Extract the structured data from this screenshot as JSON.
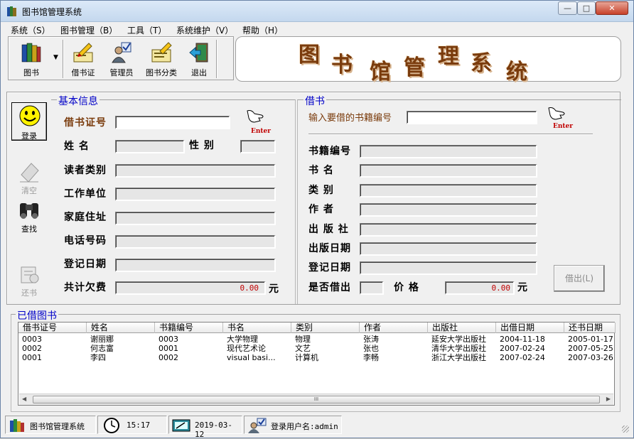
{
  "window": {
    "title": "图书馆管理系统"
  },
  "menu": [
    {
      "label": "系统（S）"
    },
    {
      "label": "图书管理（B）"
    },
    {
      "label": "工具（T）"
    },
    {
      "label": "系统维护（V）"
    },
    {
      "label": "帮助（H）"
    }
  ],
  "toolbar": {
    "books": "图书",
    "card": "借书证",
    "admin": "管理员",
    "category": "图书分类",
    "exit": "退出"
  },
  "banner": {
    "chars": [
      "图",
      "书",
      "馆",
      "管",
      "理",
      "系",
      "统"
    ]
  },
  "side_buttons": {
    "login": "登录",
    "clear": "清空",
    "find": "查找",
    "return": "还书"
  },
  "basic_info": {
    "group_title": "基本信息",
    "card_no_label": "借书证号",
    "card_no_value": "",
    "name_label": "姓    名",
    "gender_label": "性  别",
    "reader_type_label": "读者类别",
    "work_unit_label": "工作单位",
    "address_label": "家庭住址",
    "phone_label": "电话号码",
    "reg_date_label": "登记日期",
    "owed_label": "共计欠费",
    "owed_value": "0.00",
    "owed_unit": "元",
    "enter": "Enter"
  },
  "borrow": {
    "group_title": "借书",
    "input_label": "输入要借的书籍编号",
    "input_value": "",
    "enter": "Enter",
    "book_no_label": "书籍编号",
    "title_label": "书    名",
    "category_label": "类    别",
    "author_label": "作    者",
    "publisher_label": "出 版 社",
    "pub_date_label": "出版日期",
    "reg_date_label": "登记日期",
    "lent_label": "是否借出",
    "price_label": "价    格",
    "price_value": "0.00",
    "price_unit": "元",
    "borrow_button": "借出(L)"
  },
  "borrowed": {
    "title": "已借图书",
    "columns": [
      "借书证号",
      "姓名",
      "书籍编号",
      "书名",
      "类别",
      "作者",
      "出版社",
      "出借日期",
      "还书日期"
    ],
    "rows": [
      [
        "0003",
        "谢丽娜",
        "0003",
        "大学物理",
        "物理",
        "张涛",
        "延安大学出版社",
        "2004-11-18",
        "2005-01-17"
      ],
      [
        "0002",
        "何志富",
        "0001",
        "现代艺术论",
        "文艺",
        "张也",
        "清华大学出版社",
        "2007-02-24",
        "2007-05-25"
      ],
      [
        "0001",
        "李四",
        "0002",
        "visual basi...",
        "计算机",
        "李畅",
        "浙江大学出版社",
        "2007-02-24",
        "2007-03-26"
      ]
    ],
    "scroll_grip": "III"
  },
  "statusbar": {
    "app": "图书馆管理系统",
    "time": "15:17",
    "date": "2019-03-12",
    "user": "登录用户名:admin"
  },
  "colors": {
    "title_blue": "#0000c8",
    "label_brown": "#7a3b0c",
    "value_red": "#c00000"
  }
}
